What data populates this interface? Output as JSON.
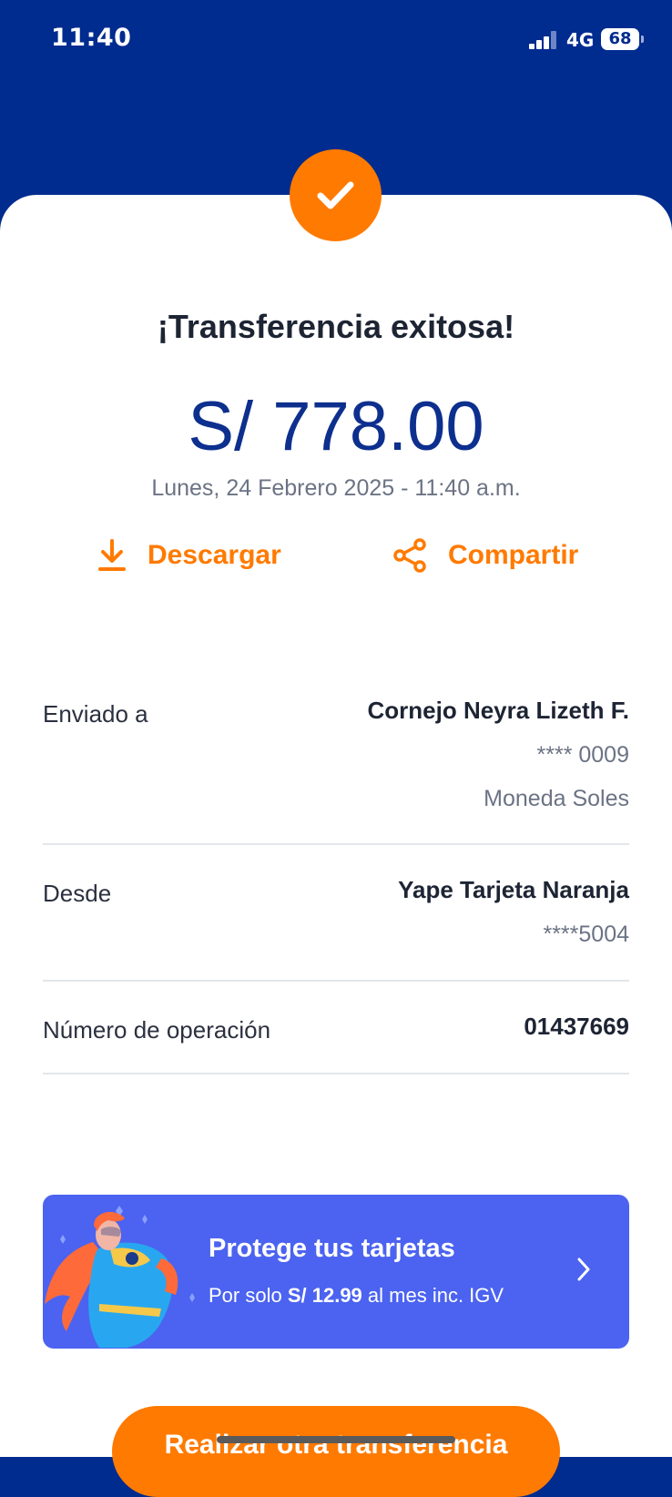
{
  "status_bar": {
    "time": "11:40",
    "network": "4G",
    "battery": "68"
  },
  "colors": {
    "header_blue": "#002b8f",
    "accent_orange": "#ff7a00",
    "amount_blue": "#0d2f8e",
    "promo_blue": "#4b63f0"
  },
  "receipt": {
    "icon": "check-icon",
    "title": "¡Transferencia exitosa!",
    "amount": "S/ 778.00",
    "datetime": "Lunes, 24 Febrero 2025 - 11:40 a.m."
  },
  "actions": {
    "download": {
      "label": "Descargar",
      "icon": "download-icon"
    },
    "share": {
      "label": "Compartir",
      "icon": "share-icon"
    }
  },
  "details": {
    "sent_to": {
      "label": "Enviado a",
      "name": "Cornejo Neyra Lizeth F.",
      "account": "**** 0009",
      "currency": "Moneda Soles"
    },
    "from": {
      "label": "Desde",
      "name": "Yape Tarjeta Naranja",
      "account": "****5004"
    },
    "operation": {
      "label": "Número de operación",
      "number": "01437669"
    }
  },
  "promo": {
    "title": "Protege tus tarjetas",
    "sub_prefix": "Por solo",
    "price": "S/ 12.99",
    "sub_suffix": "al mes inc. IGV",
    "icon": "chevron-right-icon"
  },
  "cta": {
    "label": "Realizar otra transferencia"
  }
}
